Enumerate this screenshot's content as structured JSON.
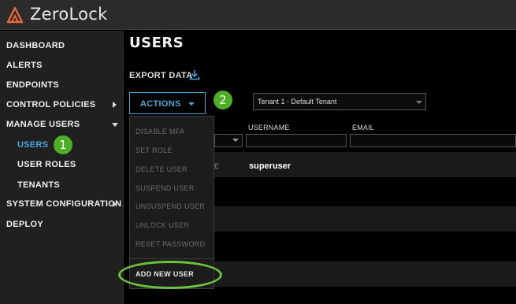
{
  "app": {
    "title": "ZeroLock",
    "brand_color": "#e8693a"
  },
  "sidebar": {
    "items": [
      {
        "label": "DASHBOARD"
      },
      {
        "label": "ALERTS"
      },
      {
        "label": "ENDPOINTS"
      },
      {
        "label": "CONTROL POLICIES",
        "icon": "caret-right-icon"
      },
      {
        "label": "MANAGE USERS",
        "icon": "caret-down-icon"
      },
      {
        "label": "USERS",
        "active": true
      },
      {
        "label": "USER ROLES"
      },
      {
        "label": "TENANTS"
      },
      {
        "label": "SYSTEM CONFIGURATION",
        "icon": "caret-right-icon"
      },
      {
        "label": "DEPLOY"
      }
    ],
    "active_color": "#46a9dc"
  },
  "callouts": {
    "step1": "1",
    "step2": "2",
    "color": "#4caf26"
  },
  "main": {
    "page_title": "USERS",
    "export_label": "EXPORT DATA",
    "export_icon": "download-icon",
    "actions_label": "ACTIONS",
    "tenant_select": {
      "value": "Tenant 1 - Default Tenant"
    },
    "columns": {
      "username": "USERNAME",
      "email": "EMAIL"
    },
    "rows": [
      {
        "fragment": "E",
        "username": "superuser"
      }
    ]
  },
  "actions_menu": {
    "items": [
      {
        "label": "DISABLE MFA",
        "enabled": false
      },
      {
        "label": "SET ROLE",
        "enabled": false
      },
      {
        "label": "DELETE USER",
        "enabled": false
      },
      {
        "label": "SUSPEND USER",
        "enabled": false
      },
      {
        "label": "UNSUSPEND USER",
        "enabled": false
      },
      {
        "label": "UNLOCK USER",
        "enabled": false
      },
      {
        "label": "RESET PASSWORD",
        "enabled": false
      },
      {
        "label": "ADD NEW USER",
        "enabled": true
      }
    ]
  }
}
